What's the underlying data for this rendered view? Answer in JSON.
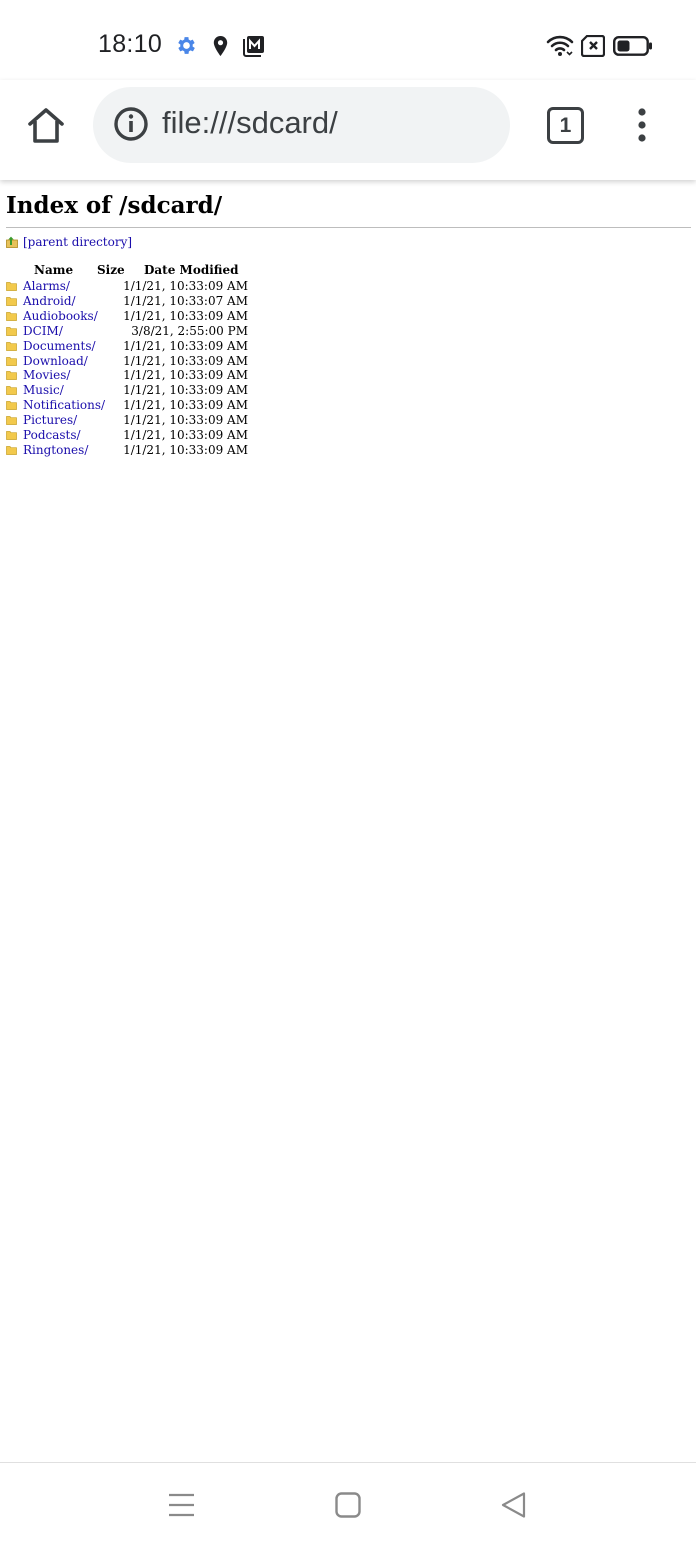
{
  "status_bar": {
    "time": "18:10",
    "icons": [
      "settings-gear-icon",
      "location-pin-icon",
      "gallery-icon",
      "wifi-icon",
      "sim-no-signal-icon",
      "battery-icon"
    ],
    "accent_color": "#4a86e8"
  },
  "toolbar": {
    "url": "file:///sdcard/",
    "tab_count": "1",
    "icons": [
      "home-icon",
      "info-icon",
      "more-vertical-icon"
    ]
  },
  "page": {
    "title": "Index of /sdcard/",
    "parent_link": "[parent directory]",
    "columns": {
      "name": "Name",
      "size": "Size",
      "date": "Date Modified"
    },
    "entries": [
      {
        "name": "Alarms/",
        "size": "",
        "date": "1/1/21, 10:33:09 AM"
      },
      {
        "name": "Android/",
        "size": "",
        "date": "1/1/21, 10:33:07 AM"
      },
      {
        "name": "Audiobooks/",
        "size": "",
        "date": "1/1/21, 10:33:09 AM"
      },
      {
        "name": "DCIM/",
        "size": "",
        "date": "3/8/21, 2:55:00 PM"
      },
      {
        "name": "Documents/",
        "size": "",
        "date": "1/1/21, 10:33:09 AM"
      },
      {
        "name": "Download/",
        "size": "",
        "date": "1/1/21, 10:33:09 AM"
      },
      {
        "name": "Movies/",
        "size": "",
        "date": "1/1/21, 10:33:09 AM"
      },
      {
        "name": "Music/",
        "size": "",
        "date": "1/1/21, 10:33:09 AM"
      },
      {
        "name": "Notifications/",
        "size": "",
        "date": "1/1/21, 10:33:09 AM"
      },
      {
        "name": "Pictures/",
        "size": "",
        "date": "1/1/21, 10:33:09 AM"
      },
      {
        "name": "Podcasts/",
        "size": "",
        "date": "1/1/21, 10:33:09 AM"
      },
      {
        "name": "Ringtones/",
        "size": "",
        "date": "1/1/21, 10:33:09 AM"
      }
    ],
    "link_color": "#1a0dab",
    "folder_color": "#f2c94c"
  },
  "nav_bar": {
    "icons": [
      "recents-menu-icon",
      "home-square-icon",
      "back-triangle-icon"
    ]
  }
}
